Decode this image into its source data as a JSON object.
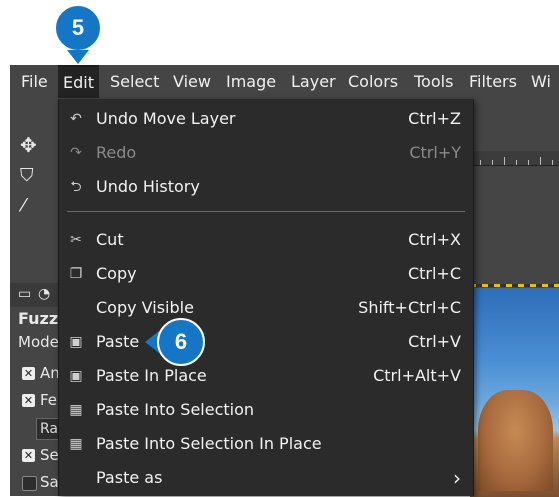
{
  "menubar": {
    "items": [
      {
        "label": "File"
      },
      {
        "label": "Edit"
      },
      {
        "label": "Select"
      },
      {
        "label": "View"
      },
      {
        "label": "Image"
      },
      {
        "label": "Layer"
      },
      {
        "label": "Colors"
      },
      {
        "label": "Tools"
      },
      {
        "label": "Filters"
      },
      {
        "label": "Wi"
      }
    ],
    "active": "Edit"
  },
  "edit_menu": {
    "items": [
      {
        "icon": "undo-icon",
        "label": "Undo Move Layer",
        "shortcut": "Ctrl+Z",
        "enabled": true
      },
      {
        "icon": "redo-icon",
        "label": "Redo",
        "shortcut": "Ctrl+Y",
        "enabled": false
      },
      {
        "icon": "undo-history-icon",
        "label": "Undo History",
        "shortcut": "",
        "enabled": true
      },
      {
        "icon": "scissors-icon",
        "label": "Cut",
        "shortcut": "Ctrl+X",
        "enabled": true
      },
      {
        "icon": "copy-icon",
        "label": "Copy",
        "shortcut": "Ctrl+C",
        "enabled": true
      },
      {
        "icon": "",
        "label": "Copy Visible",
        "shortcut": "Shift+Ctrl+C",
        "enabled": true
      },
      {
        "icon": "paste-icon",
        "label": "Paste",
        "shortcut": "Ctrl+V",
        "enabled": true
      },
      {
        "icon": "paste-in-place-icon",
        "label": "Paste In Place",
        "shortcut": "Ctrl+Alt+V",
        "enabled": true
      },
      {
        "icon": "paste-into-selection-icon",
        "label": "Paste Into Selection",
        "shortcut": "",
        "enabled": true
      },
      {
        "icon": "paste-into-selection-in-place-icon",
        "label": "Paste Into Selection In Place",
        "shortcut": "",
        "enabled": true
      },
      {
        "icon": "",
        "label": "Paste as",
        "shortcut": "",
        "enabled": true,
        "submenu": true
      }
    ],
    "submenu_arrow": "›"
  },
  "tool_options": {
    "title": "Fuzz",
    "mode_label": "Mode",
    "option_1": "An",
    "option_2": "Fe",
    "field_value": "Ra",
    "option_3": "Se",
    "option_4": "Sa"
  },
  "callouts": {
    "step_5": "5",
    "step_6": "6",
    "color": "#1576c5"
  }
}
